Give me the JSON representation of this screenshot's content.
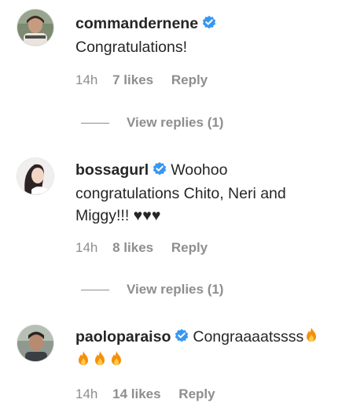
{
  "colors": {
    "text": "#262626",
    "meta": "#8e8e8e",
    "verified": "#3897f0",
    "fire_outer": "#f4900c",
    "fire_inner": "#ffcc4d"
  },
  "comments": [
    {
      "username": "commandernene",
      "verified": true,
      "text": "Congratulations!",
      "time": "14h",
      "likes": "7 likes",
      "reply": "Reply",
      "view_replies": "View replies (1)",
      "avatar_icon": "avatar-commandernene"
    },
    {
      "username": "bossagurl",
      "verified": true,
      "text": "Woohoo congratulations Chito, Neri and Miggy!!! ♥♥♥",
      "time": "14h",
      "likes": "8 likes",
      "reply": "Reply",
      "view_replies": "View replies (1)",
      "avatar_icon": "avatar-bossagurl"
    },
    {
      "username": "paoloparaiso",
      "verified": true,
      "text": "Congraaaatssss",
      "emoji": [
        "fire-icon",
        "fire-icon",
        "fire-icon",
        "fire-icon"
      ],
      "time": "14h",
      "likes": "14 likes",
      "reply": "Reply",
      "avatar_icon": "avatar-paoloparaiso"
    }
  ]
}
